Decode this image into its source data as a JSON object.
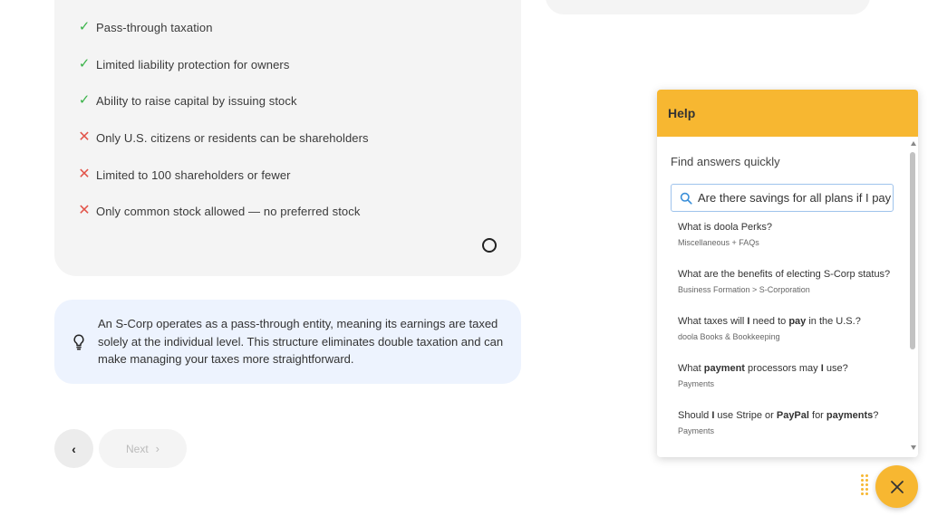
{
  "features": {
    "pros": [
      "Pass-through taxation",
      "Limited liability protection for owners",
      "Ability to raise capital by issuing stock"
    ],
    "cons": [
      "Only U.S. citizens or residents can be shareholders",
      "Limited to 100 shareholders or fewer",
      "Only common stock allowed — no preferred stock"
    ],
    "pro_mark": "✓",
    "con_mark": "✕"
  },
  "info": {
    "text": "An S-Corp operates as a pass-through entity, meaning its earnings are taxed solely at the individual level. This structure eliminates double taxation and can make managing your taxes more straightforward.",
    "icon": "lightbulb-icon"
  },
  "nav": {
    "back_label": "‹",
    "next_label": "Next",
    "next_chevron": "›"
  },
  "help": {
    "title": "Help",
    "subtitle": "Find answers quickly",
    "search_value": "Are there savings for all plans if I pay y",
    "results": [
      {
        "question_html": "What is doola Perks?",
        "category": "Miscellaneous + FAQs"
      },
      {
        "question_html": "What are the benefits of electing S-Corp status?",
        "category": "Business Formation  > S-Corporation"
      },
      {
        "question_html": "What taxes will <b>I</b> need to <b>pay</b> in the U.S.?",
        "category": "doola Books & Bookkeeping"
      },
      {
        "question_html": "What <b>payment</b> processors may <b>I</b> use?",
        "category": "Payments"
      },
      {
        "question_html": "Should <b>I</b> use Stripe or <b>PayPal</b> for <b>payments</b>?",
        "category": "Payments"
      }
    ],
    "accent_color": "#f7b731"
  },
  "colors": {
    "pro": "#3bb34a",
    "con": "#e2544a",
    "card_bg": "#f4f4f4",
    "info_bg": "#edf3fe"
  }
}
